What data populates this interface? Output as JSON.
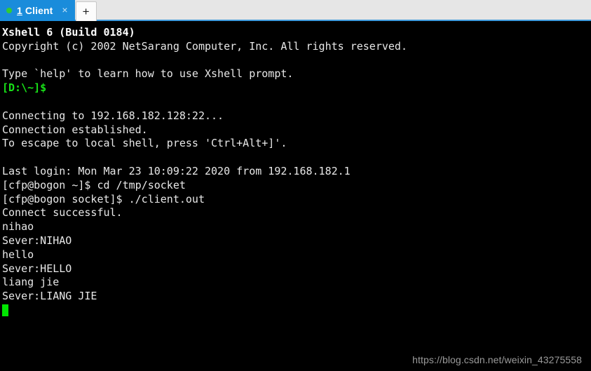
{
  "window": {
    "accent_color": "#1a8cdb",
    "tabbar_bg": "#e6e6e6",
    "terminal_bg": "#000000",
    "terminal_fg": "#e8e8e8",
    "prompt_color": "#18e018",
    "cursor_color": "#00e600"
  },
  "tabbar": {
    "tab": {
      "status_dot": "connected-dot",
      "accel": "1",
      "label_rest": " Client",
      "full_label": "1 Client",
      "close_label": "×"
    },
    "new_tab_label": "+"
  },
  "terminal": {
    "lines": [
      {
        "text": "Xshell 6 (Build 0184)",
        "style": "bold"
      },
      {
        "text": "Copyright (c) 2002 NetSarang Computer, Inc. All rights reserved.",
        "style": "normal"
      },
      {
        "text": "",
        "style": "blank"
      },
      {
        "text": "Type `help' to learn how to use Xshell prompt.",
        "style": "normal"
      },
      {
        "text": "[D:\\~]$",
        "style": "green"
      },
      {
        "text": "",
        "style": "blank"
      },
      {
        "text": "Connecting to 192.168.182.128:22...",
        "style": "normal"
      },
      {
        "text": "Connection established.",
        "style": "normal"
      },
      {
        "text": "To escape to local shell, press 'Ctrl+Alt+]'.",
        "style": "normal"
      },
      {
        "text": "",
        "style": "blank"
      },
      {
        "text": "Last login: Mon Mar 23 10:09:22 2020 from 192.168.182.1",
        "style": "normal"
      },
      {
        "text": "[cfp@bogon ~]$ cd /tmp/socket",
        "style": "normal"
      },
      {
        "text": "[cfp@bogon socket]$ ./client.out",
        "style": "normal"
      },
      {
        "text": "Connect successful.",
        "style": "normal"
      },
      {
        "text": "nihao",
        "style": "normal"
      },
      {
        "text": "Sever:NIHAO",
        "style": "normal"
      },
      {
        "text": "hello",
        "style": "normal"
      },
      {
        "text": "Sever:HELLO",
        "style": "normal"
      },
      {
        "text": "liang jie",
        "style": "normal"
      },
      {
        "text": "Sever:LIANG JIE",
        "style": "normal"
      }
    ],
    "watermark": "https://blog.csdn.net/weixin_43275558"
  }
}
